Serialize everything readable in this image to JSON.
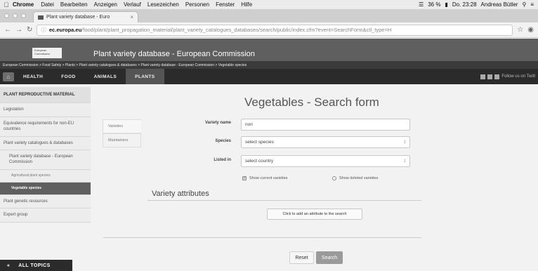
{
  "mac_menubar": {
    "app_name": "Chrome",
    "menus": [
      "Datei",
      "Bearbeiten",
      "Anzeigen",
      "Verlauf",
      "Lesezeichen",
      "Personen",
      "Fenster",
      "Hilfe"
    ],
    "battery": "36 %",
    "datetime": "Do. 23:28",
    "user": "Andreas Bütler"
  },
  "browser": {
    "tab_title": "Plant variety database - Euro",
    "url_domain": "ec.europa.eu",
    "url_path": "/food/plant/plant_propagation_material/plant_variety_catalogues_databases/search/public/index.cfm?event=SearchForm&ctl_type=H"
  },
  "site_header": {
    "logo_text": "European Commission",
    "title": "Plant variety database - European Commission",
    "breadcrumb": "European Commission > Food Safety > Plants > Plant variety catalogues & databases > Plant variety database - European Commission > Vegetable species"
  },
  "nav": {
    "items": [
      "HEALTH",
      "FOOD",
      "ANIMALS",
      "PLANTS"
    ],
    "active": "PLANTS",
    "social_text": "Follow us on Twitt"
  },
  "sidebar": {
    "heading": "PLANT REPRODUCTIVE MATERIAL",
    "items": [
      "Legislation",
      "Equivalence requirements for non-EU countries",
      "Plant variety catalogues & databases",
      "Plant variety database - European Commission",
      "Agricultural plant species",
      "Vegetable species",
      "Plant genetic resources",
      "Expert group"
    ],
    "all_topics": "ALL TOPICS",
    "all_topics_icon": "«"
  },
  "main": {
    "title": "Vegetables - Search form",
    "tabs": [
      "Varieties",
      "Maintainers"
    ],
    "form": {
      "variety_name_label": "Variety name",
      "variety_name_value": "nori",
      "species_label": "Species",
      "species_value": "select species",
      "listed_in_label": "Listed in",
      "listed_in_value": "select country",
      "show_current_label": "Show current varieties",
      "show_current_checked": true,
      "show_deleted_label": "Show deleted varieties",
      "show_deleted_checked": false
    },
    "attributes_title": "Variety attributes",
    "add_attribute_label": "Click to add an attribute to the search",
    "reset_label": "Reset",
    "search_label": "Search"
  }
}
